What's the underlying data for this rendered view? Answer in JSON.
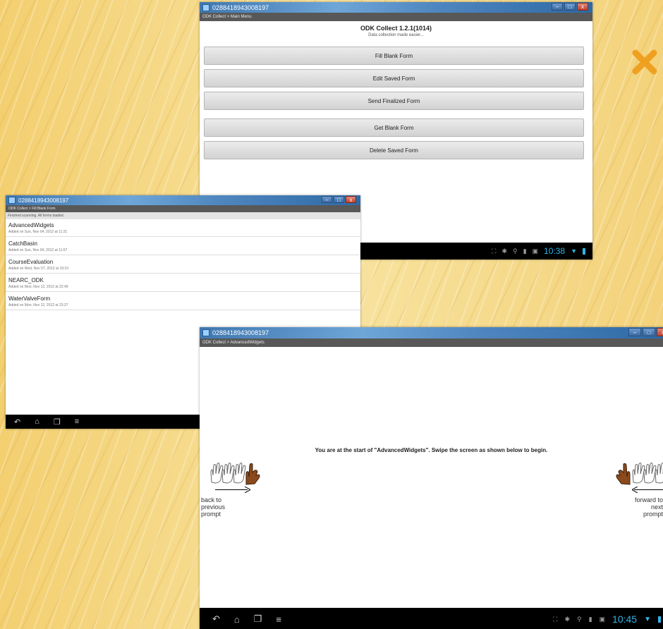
{
  "main_menu_window": {
    "title": "0288418943008197",
    "breadcrumb": "ODK Collect > Main Menu",
    "app_title": "ODK Collect 1.2.1(1014)",
    "tagline": "Data collection made easier...",
    "buttons": [
      "Fill Blank Form",
      "Edit Saved Form",
      "Send Finalized Form",
      "Get Blank Form",
      "Delete Saved Form"
    ],
    "clock": "10:38"
  },
  "form_list_window": {
    "title": "0288418943008197",
    "breadcrumb": "ODK Collect > Fill Blank Form",
    "status": "Finished scanning. All forms loaded.",
    "forms": [
      {
        "name": "AdvancedWidgets",
        "added": "Added on Sun, Nov 04, 2012 at 11:31"
      },
      {
        "name": "CatchBasin",
        "added": "Added on Sun, Nov 04, 2012 at 11:57"
      },
      {
        "name": "CourseEvaluation",
        "added": "Added on Wed, Nov 07, 2012 at 19:10"
      },
      {
        "name": "NEARC_ODK",
        "added": "Added on Mon, Nov 12, 2012 at 22:49"
      },
      {
        "name": "WaterValveForm",
        "added": "Added on Mon, Nov 12, 2012 at 23:27"
      }
    ]
  },
  "form_start_window": {
    "title": "0288418943008197",
    "breadcrumb": "ODK Collect > AdvancedWidgets",
    "message": "You are at the start of \"AdvancedWidgets\". Swipe the screen as shown below to begin.",
    "back_hint": [
      "back to",
      "previous",
      "prompt"
    ],
    "forward_hint": [
      "forward to",
      "next",
      "prompt"
    ],
    "clock": "10:45"
  },
  "colors": {
    "accent_clock": "#31b5e6",
    "bullet_x": "#f0a020",
    "titlebar": "#4f86bf",
    "appbar": "#585858"
  },
  "icons": {
    "bullet": "x-bullet-icon",
    "nav": [
      "back-icon",
      "home-icon",
      "recent-apps-icon",
      "menu-icon"
    ]
  }
}
